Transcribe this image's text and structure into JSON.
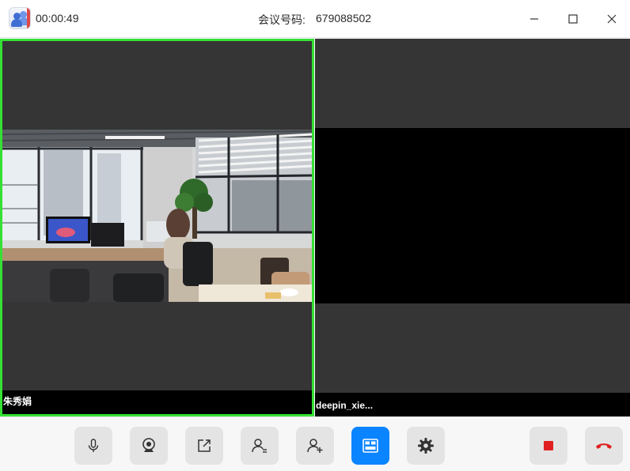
{
  "titlebar": {
    "timer": "00:00:49",
    "meeting_label": "会议号码:",
    "meeting_id": "679088502",
    "icons": [
      "meeting-app-icon",
      "minimize-icon",
      "maximize-icon",
      "close-icon"
    ]
  },
  "participants": [
    {
      "name": "朱秀娟",
      "active_speaker": true,
      "video": "office-camera-feed",
      "highlight_color": "#35e035"
    },
    {
      "name": "deepin_xie...",
      "active_speaker": false,
      "video": "black-screen"
    }
  ],
  "toolbar": {
    "buttons": [
      {
        "name": "microphone",
        "icon": "microphone-icon",
        "active": false
      },
      {
        "name": "camera",
        "icon": "webcam-icon",
        "active": false
      },
      {
        "name": "share-screen",
        "icon": "share-icon",
        "active": false
      },
      {
        "name": "participants",
        "icon": "user-list-icon",
        "active": false
      },
      {
        "name": "invite",
        "icon": "user-add-icon",
        "active": false
      },
      {
        "name": "layout",
        "icon": "grid-layout-icon",
        "active": true
      },
      {
        "name": "settings",
        "icon": "gear-icon",
        "active": false
      },
      {
        "name": "record",
        "icon": "stop-icon",
        "active": false
      },
      {
        "name": "hang-up",
        "icon": "phone-hangup-icon",
        "active": false
      }
    ]
  },
  "colors": {
    "accent": "#0a84ff",
    "active_speaker_border": "#35e035",
    "record": "#e02020",
    "hang_up": "#e02020",
    "video_bg": "#353535"
  }
}
